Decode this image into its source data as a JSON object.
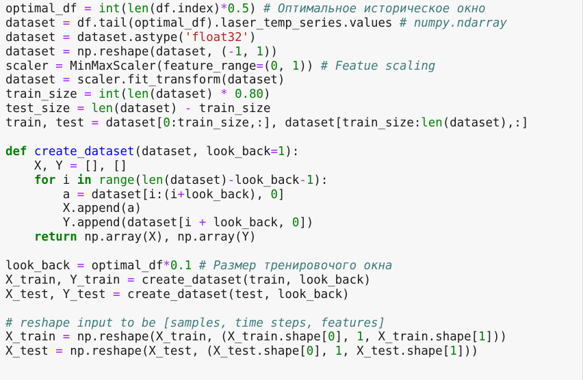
{
  "colors": {
    "background": "#f7f7f7",
    "text": "#1a1a1a",
    "keyword": "#008000",
    "builtin": "#008000",
    "function_name": "#0000ff",
    "operator": "#aa22ff",
    "number": "#008000",
    "string": "#ba2121",
    "comment": "#3d7b7b"
  },
  "code_lines": [
    [
      [
        "t",
        "optimal_df "
      ],
      [
        "o",
        "="
      ],
      [
        "t",
        " "
      ],
      [
        "b",
        "int"
      ],
      [
        "t",
        "("
      ],
      [
        "b",
        "len"
      ],
      [
        "t",
        "(df.index)"
      ],
      [
        "o",
        "*"
      ],
      [
        "n",
        "0.5"
      ],
      [
        "t",
        ") "
      ],
      [
        "c",
        "# Оптимальное историческое окно"
      ]
    ],
    [
      [
        "t",
        "dataset "
      ],
      [
        "o",
        "="
      ],
      [
        "t",
        " df.tail(optimal_df).laser_temp_series.values "
      ],
      [
        "c",
        "# numpy.ndarray"
      ]
    ],
    [
      [
        "t",
        "dataset "
      ],
      [
        "o",
        "="
      ],
      [
        "t",
        " dataset.astype("
      ],
      [
        "s",
        "'float32'"
      ],
      [
        "t",
        ")"
      ]
    ],
    [
      [
        "t",
        "dataset "
      ],
      [
        "o",
        "="
      ],
      [
        "t",
        " np.reshape(dataset, ("
      ],
      [
        "o",
        "-"
      ],
      [
        "n",
        "1"
      ],
      [
        "t",
        ", "
      ],
      [
        "n",
        "1"
      ],
      [
        "t",
        "))"
      ]
    ],
    [
      [
        "t",
        "scaler "
      ],
      [
        "o",
        "="
      ],
      [
        "t",
        " MinMaxScaler(feature_range"
      ],
      [
        "o",
        "="
      ],
      [
        "t",
        "("
      ],
      [
        "n",
        "0"
      ],
      [
        "t",
        ", "
      ],
      [
        "n",
        "1"
      ],
      [
        "t",
        ")) "
      ],
      [
        "c",
        "# Featue scaling"
      ]
    ],
    [
      [
        "t",
        "dataset "
      ],
      [
        "o",
        "="
      ],
      [
        "t",
        " scaler.fit_transform(dataset)"
      ]
    ],
    [
      [
        "t",
        "train_size "
      ],
      [
        "o",
        "="
      ],
      [
        "t",
        " "
      ],
      [
        "b",
        "int"
      ],
      [
        "t",
        "("
      ],
      [
        "b",
        "len"
      ],
      [
        "t",
        "(dataset) "
      ],
      [
        "o",
        "*"
      ],
      [
        "t",
        " "
      ],
      [
        "n",
        "0.80"
      ],
      [
        "t",
        ")"
      ]
    ],
    [
      [
        "t",
        "test_size "
      ],
      [
        "o",
        "="
      ],
      [
        "t",
        " "
      ],
      [
        "b",
        "len"
      ],
      [
        "t",
        "(dataset) "
      ],
      [
        "o",
        "-"
      ],
      [
        "t",
        " train_size"
      ]
    ],
    [
      [
        "t",
        "train, test "
      ],
      [
        "o",
        "="
      ],
      [
        "t",
        " dataset["
      ],
      [
        "n",
        "0"
      ],
      [
        "t",
        ":train_size,:], dataset[train_size:"
      ],
      [
        "b",
        "len"
      ],
      [
        "t",
        "(dataset),:]"
      ]
    ],
    [],
    [
      [
        "k",
        "def"
      ],
      [
        "t",
        " "
      ],
      [
        "f",
        "create_dataset"
      ],
      [
        "t",
        "(dataset, look_back"
      ],
      [
        "o",
        "="
      ],
      [
        "n",
        "1"
      ],
      [
        "t",
        "):"
      ]
    ],
    [
      [
        "t",
        "    X, Y "
      ],
      [
        "o",
        "="
      ],
      [
        "t",
        " [], []"
      ]
    ],
    [
      [
        "t",
        "    "
      ],
      [
        "k",
        "for"
      ],
      [
        "t",
        " i "
      ],
      [
        "k",
        "in"
      ],
      [
        "t",
        " "
      ],
      [
        "b",
        "range"
      ],
      [
        "t",
        "("
      ],
      [
        "b",
        "len"
      ],
      [
        "t",
        "(dataset)"
      ],
      [
        "o",
        "-"
      ],
      [
        "t",
        "look_back"
      ],
      [
        "o",
        "-"
      ],
      [
        "n",
        "1"
      ],
      [
        "t",
        "):"
      ]
    ],
    [
      [
        "t",
        "        a "
      ],
      [
        "o",
        "="
      ],
      [
        "t",
        " dataset[i:(i"
      ],
      [
        "o",
        "+"
      ],
      [
        "t",
        "look_back), "
      ],
      [
        "n",
        "0"
      ],
      [
        "t",
        "]"
      ]
    ],
    [
      [
        "t",
        "        X.append(a)"
      ]
    ],
    [
      [
        "t",
        "        Y.append(dataset[i "
      ],
      [
        "o",
        "+"
      ],
      [
        "t",
        " look_back, "
      ],
      [
        "n",
        "0"
      ],
      [
        "t",
        "])"
      ]
    ],
    [
      [
        "t",
        "    "
      ],
      [
        "k",
        "return"
      ],
      [
        "t",
        " np.array(X), np.array(Y)"
      ]
    ],
    [],
    [
      [
        "t",
        "look_back "
      ],
      [
        "o",
        "="
      ],
      [
        "t",
        " optimal_df"
      ],
      [
        "o",
        "*"
      ],
      [
        "n",
        "0.1"
      ],
      [
        "t",
        " "
      ],
      [
        "c",
        "# Размер тренировочого окна"
      ]
    ],
    [
      [
        "t",
        "X_train, Y_train "
      ],
      [
        "o",
        "="
      ],
      [
        "t",
        " create_dataset(train, look_back)"
      ]
    ],
    [
      [
        "t",
        "X_test, Y_test "
      ],
      [
        "o",
        "="
      ],
      [
        "t",
        " create_dataset(test, look_back)"
      ]
    ],
    [],
    [
      [
        "c",
        "# reshape input to be [samples, time steps, features]"
      ]
    ],
    [
      [
        "t",
        "X_train "
      ],
      [
        "o",
        "="
      ],
      [
        "t",
        " np.reshape(X_train, (X_train.shape["
      ],
      [
        "n",
        "0"
      ],
      [
        "t",
        "], "
      ],
      [
        "n",
        "1"
      ],
      [
        "t",
        ", X_train.shape["
      ],
      [
        "n",
        "1"
      ],
      [
        "t",
        "]))"
      ]
    ],
    [
      [
        "t",
        "X_test "
      ],
      [
        "o",
        "="
      ],
      [
        "t",
        " np.reshape(X_test, (X_test.shape["
      ],
      [
        "n",
        "0"
      ],
      [
        "t",
        "], "
      ],
      [
        "n",
        "1"
      ],
      [
        "t",
        ", X_test.shape["
      ],
      [
        "n",
        "1"
      ],
      [
        "t",
        "]))"
      ]
    ]
  ]
}
